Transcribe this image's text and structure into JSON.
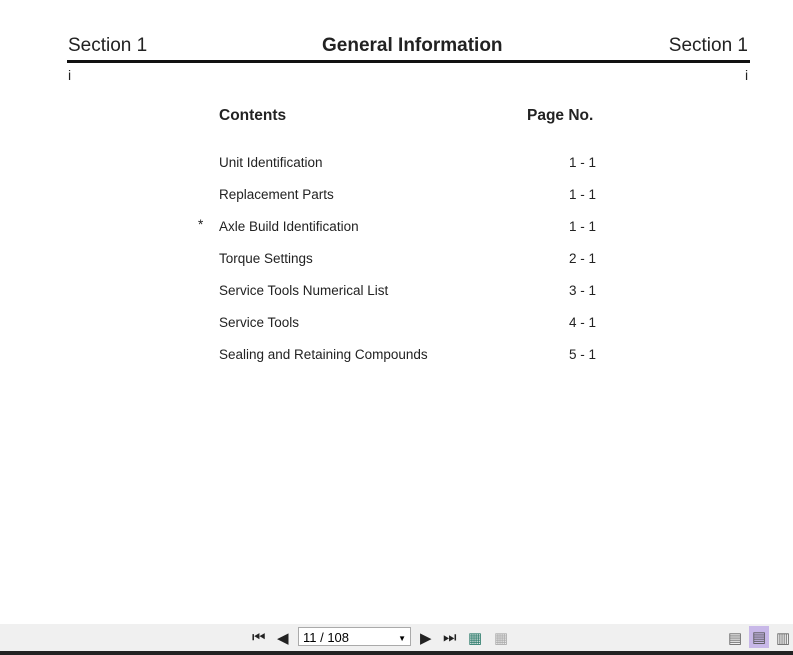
{
  "header": {
    "left": "Section 1",
    "title": "General Information",
    "right": "Section 1",
    "page_left": "i",
    "page_right": "i"
  },
  "contents": {
    "heading": "Contents",
    "page_heading": "Page No.",
    "items": [
      {
        "marker": "",
        "label": "Unit Identification",
        "page": "1 - 1"
      },
      {
        "marker": "",
        "label": "Replacement Parts",
        "page": "1 - 1"
      },
      {
        "marker": "*",
        "label": "Axle Build Identification",
        "page": "1 - 1"
      },
      {
        "marker": "",
        "label": "Torque Settings",
        "page": "2 - 1"
      },
      {
        "marker": "",
        "label": "Service Tools Numerical List",
        "page": "3 - 1"
      },
      {
        "marker": "",
        "label": "Service Tools",
        "page": "4 - 1"
      },
      {
        "marker": "",
        "label": "Sealing and Retaining Compounds",
        "page": "5 - 1"
      }
    ]
  },
  "toolbar": {
    "page_value": "11 / 108",
    "active_view_color": "#c8b8e8"
  }
}
